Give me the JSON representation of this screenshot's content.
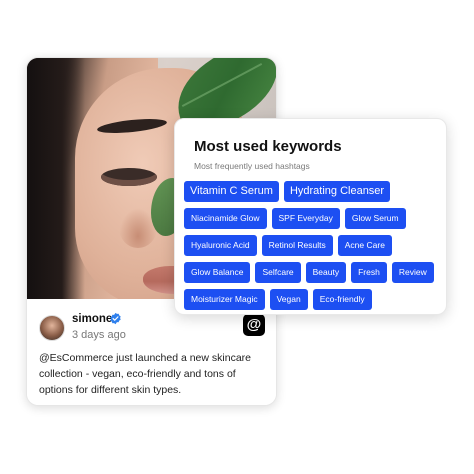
{
  "post": {
    "username": "simone",
    "timestamp": "3 days ago",
    "text": "@EsCommerce just launched a new skincare collection - vegan, eco-friendly and tons of options for different skin types.",
    "platform_icon": "threads-icon",
    "verified_icon": "verified-badge-icon"
  },
  "keywords": {
    "title": "Most used keywords",
    "subtitle": "Most frequently used hashtags",
    "tags": [
      "Vitamin C Serum",
      "Hydrating Cleanser",
      "Niacinamide Glow",
      "SPF Everyday",
      "Glow Serum",
      "Hyaluronic Acid",
      "Retinol Results",
      "Acne Care",
      "Glow Balance",
      "Selfcare",
      "Beauty",
      "Fresh",
      "Review",
      "Moisturizer Magic",
      "Vegan",
      "Eco-friendly"
    ]
  },
  "colors": {
    "tag_bg": "#1d4ff2",
    "verified": "#2f80ed"
  }
}
